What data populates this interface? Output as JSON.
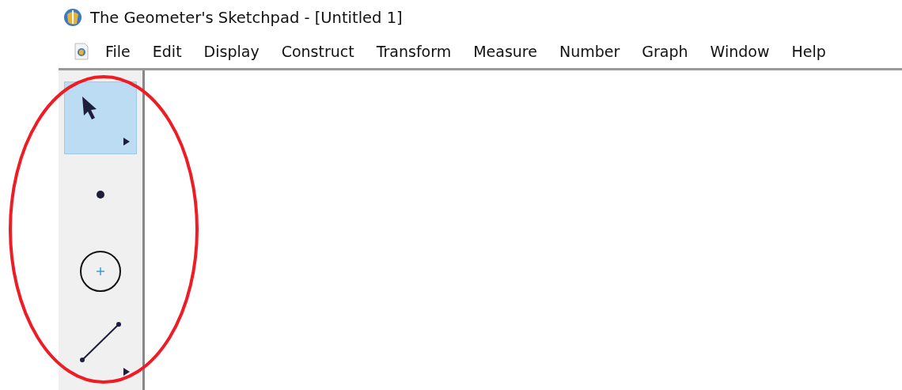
{
  "window": {
    "title": "The Geometer's Sketchpad - [Untitled 1]"
  },
  "menu": [
    "File",
    "Edit",
    "Display",
    "Construct",
    "Transform",
    "Measure",
    "Number",
    "Graph",
    "Window",
    "Help"
  ],
  "toolbox": [
    {
      "kind": "select",
      "selected": true,
      "submenu": true
    },
    {
      "kind": "point",
      "selected": false,
      "submenu": false
    },
    {
      "kind": "compass",
      "selected": false,
      "submenu": false
    },
    {
      "kind": "line",
      "selected": false,
      "submenu": true
    }
  ],
  "annotation": {
    "kind": "ellipse",
    "color": "#ee1c25"
  }
}
